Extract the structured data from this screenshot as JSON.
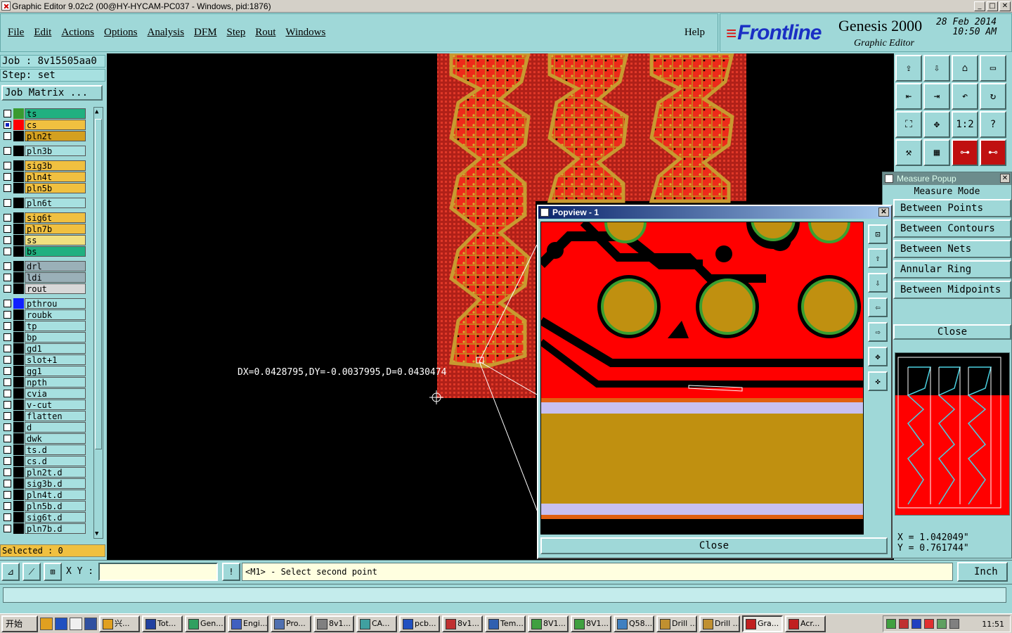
{
  "window": {
    "title": "Graphic Editor 9.02c2 (00@HY-HYCAM-PC037 - Windows, pid:1876)"
  },
  "menu": {
    "items": [
      {
        "label": "File"
      },
      {
        "label": "Edit"
      },
      {
        "label": "Actions"
      },
      {
        "label": "Options"
      },
      {
        "label": "Analysis"
      },
      {
        "label": "DFM"
      },
      {
        "label": "Step"
      },
      {
        "label": "Rout"
      },
      {
        "label": "Windows"
      }
    ],
    "help": "Help"
  },
  "logo": {
    "brand": "Frontline",
    "product": "Genesis 2000",
    "subtitle": "Graphic Editor",
    "date": "28 Feb 2014",
    "time": "10:50 AM"
  },
  "job": {
    "job_label": "Job : 8v15505aa0",
    "step_label": "Step: set",
    "matrix_button": "Job Matrix ..."
  },
  "layers": [
    {
      "name": "ts",
      "color": "#20b080",
      "swatch": "#3a9a30",
      "checked": false
    },
    {
      "name": "cs",
      "color": "#f0c040",
      "swatch": "#ff0000",
      "checked": true
    },
    {
      "name": "pln2t",
      "color": "#d4a020",
      "swatch": "#000000",
      "checked": false
    },
    {
      "name": "pln3b",
      "color": "#a7e0e0",
      "swatch": "#000000",
      "checked": false
    },
    {
      "name": "sig3b",
      "color": "#f0c040",
      "swatch": "#000000",
      "checked": false
    },
    {
      "name": "pln4t",
      "color": "#f0c040",
      "swatch": "#000000",
      "checked": false
    },
    {
      "name": "pln5b",
      "color": "#f0c040",
      "swatch": "#000000",
      "checked": false
    },
    {
      "name": "pln6t",
      "color": "#a7e0e0",
      "swatch": "#000000",
      "checked": false
    },
    {
      "name": "sig6t",
      "color": "#f0c040",
      "swatch": "#000000",
      "checked": false
    },
    {
      "name": "pln7b",
      "color": "#f0c040",
      "swatch": "#000000",
      "checked": false
    },
    {
      "name": "ss",
      "color": "#f0e080",
      "swatch": "#000000",
      "checked": false
    },
    {
      "name": "bs",
      "color": "#20b080",
      "swatch": "#000000",
      "checked": false
    },
    {
      "name": "drl",
      "color": "#9ab0b8",
      "swatch": "#000000",
      "checked": false
    },
    {
      "name": "ldi",
      "color": "#9ab0b8",
      "swatch": "#000000",
      "checked": false
    },
    {
      "name": "rout",
      "color": "#d8d8d8",
      "swatch": "#000000",
      "checked": false
    },
    {
      "name": "pthrou",
      "color": "#a7e0e0",
      "swatch": "#1020ff",
      "checked": false
    },
    {
      "name": "roubk",
      "color": "#a7e0e0",
      "swatch": "#000000",
      "checked": false
    },
    {
      "name": "tp",
      "color": "#a7e0e0",
      "swatch": "#000000",
      "checked": false
    },
    {
      "name": "bp",
      "color": "#a7e0e0",
      "swatch": "#000000",
      "checked": false
    },
    {
      "name": "gd1",
      "color": "#a7e0e0",
      "swatch": "#000000",
      "checked": false
    },
    {
      "name": "slot+1",
      "color": "#a7e0e0",
      "swatch": "#000000",
      "checked": false
    },
    {
      "name": "gg1",
      "color": "#a7e0e0",
      "swatch": "#000000",
      "checked": false
    },
    {
      "name": "npth",
      "color": "#a7e0e0",
      "swatch": "#000000",
      "checked": false
    },
    {
      "name": "cvia",
      "color": "#a7e0e0",
      "swatch": "#000000",
      "checked": false
    },
    {
      "name": "v-cut",
      "color": "#a7e0e0",
      "swatch": "#000000",
      "checked": false
    },
    {
      "name": "flatten",
      "color": "#a7e0e0",
      "swatch": "#000000",
      "checked": false
    },
    {
      "name": "d",
      "color": "#a7e0e0",
      "swatch": "#000000",
      "checked": false
    },
    {
      "name": "dwk",
      "color": "#a7e0e0",
      "swatch": "#000000",
      "checked": false
    },
    {
      "name": "ts.d",
      "color": "#a7e0e0",
      "swatch": "#000000",
      "checked": false
    },
    {
      "name": "cs.d",
      "color": "#a7e0e0",
      "swatch": "#000000",
      "checked": false
    },
    {
      "name": "pln2t.d",
      "color": "#a7e0e0",
      "swatch": "#000000",
      "checked": false
    },
    {
      "name": "sig3b.d",
      "color": "#a7e0e0",
      "swatch": "#000000",
      "checked": false
    },
    {
      "name": "pln4t.d",
      "color": "#a7e0e0",
      "swatch": "#000000",
      "checked": false
    },
    {
      "name": "pln5b.d",
      "color": "#a7e0e0",
      "swatch": "#000000",
      "checked": false
    },
    {
      "name": "sig6t.d",
      "color": "#a7e0e0",
      "swatch": "#000000",
      "checked": false
    },
    {
      "name": "pln7b.d",
      "color": "#a7e0e0",
      "swatch": "#000000",
      "checked": false
    }
  ],
  "selected_label": "Selected : 0",
  "measurement": {
    "readout": "DX=0.0428795,DY=-0.0037995,D=0.0430474"
  },
  "measure_popup": {
    "title": "Measure Popup",
    "mode_label": "Measure Mode",
    "options": [
      "Between Points",
      "Between Contours",
      "Between Nets",
      "Annular Ring",
      "Between Midpoints"
    ],
    "close": "Close",
    "x_readout": "X = 1.042049\"",
    "y_readout": "Y = 0.761744\""
  },
  "popview": {
    "title": "Popview - 1",
    "close": "Close"
  },
  "right_tools": [
    "zoom-home-icon",
    "zoom-in-icon",
    "home-icon",
    "window-icon",
    "pan-left-icon",
    "pan-right-icon",
    "undo-view-icon",
    "redraw-icon",
    "fit-icon",
    "center-icon",
    "ratio-icon",
    "help-icon",
    "tools-icon",
    "grid-icon",
    "net-icon",
    "net-highlight-icon"
  ],
  "bottom": {
    "xy_label": "X Y :",
    "xy_value": "",
    "prompt": "<M1> - Select second point",
    "unit": "Inch"
  },
  "taskbar": {
    "start": "开始",
    "tasks": [
      "兴...",
      "Tot...",
      "Gen...",
      "Engi...",
      "Pro...",
      "8v1...",
      "CA...",
      "pcb...",
      "8v1...",
      "Tem...",
      "8V1...",
      "8V1...",
      "Q58...",
      "Drill ...",
      "Drill ...",
      "Gra...",
      "Acr..."
    ],
    "clock": "11:51"
  }
}
